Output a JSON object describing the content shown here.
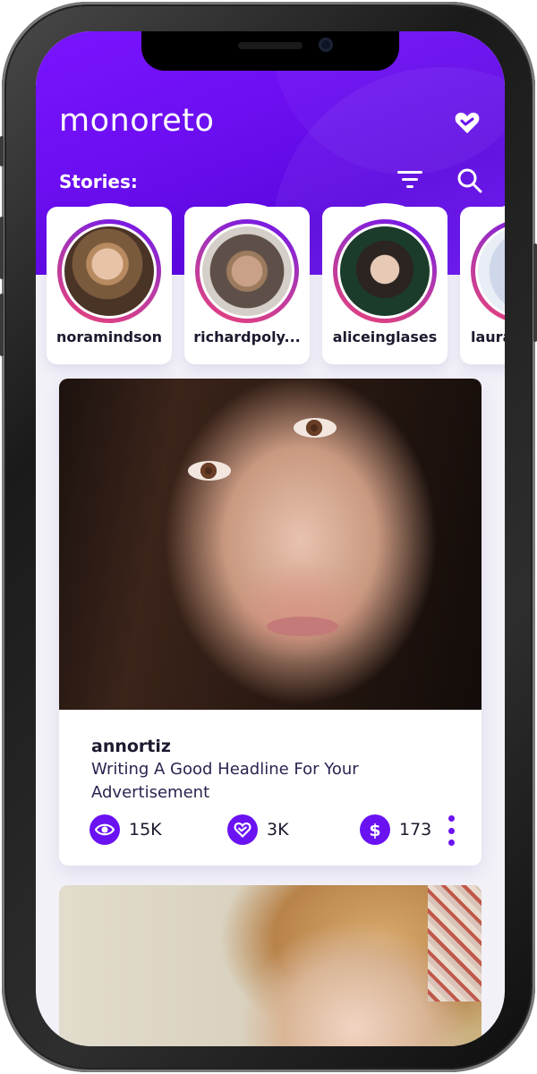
{
  "app": {
    "logo_text": "monoreto",
    "logo_icon": "heart-icon"
  },
  "toolbar": {
    "stories_label": "Stories:",
    "filter_icon": "filter-icon",
    "search_icon": "search-icon"
  },
  "stories": [
    {
      "username": "noramindson"
    },
    {
      "username": "richardpoly..."
    },
    {
      "username": "aliceinglases"
    },
    {
      "username": "laura"
    }
  ],
  "post": {
    "author": "annortiz",
    "headline": "Writing A Good Headline For Your Advertisement",
    "stats": {
      "views": "15K",
      "likes": "3K",
      "earnings": "173"
    },
    "icons": [
      "eye-icon",
      "heart-icon",
      "dollar-icon",
      "more-vertical-icon"
    ]
  },
  "colors": {
    "accent": "#6a12f2",
    "header_gradient_start": "#7a14ff",
    "header_gradient_end": "#5c08e0",
    "ring_pink": "#e8417a"
  }
}
